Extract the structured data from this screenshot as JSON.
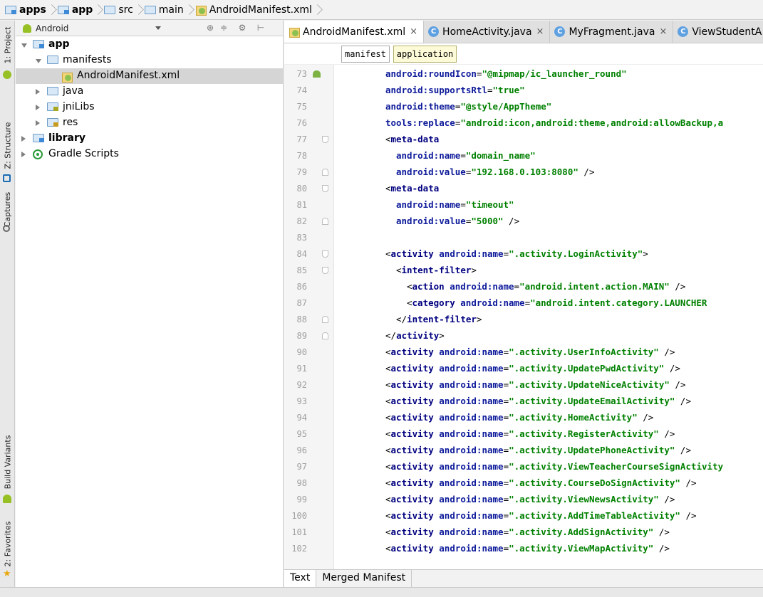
{
  "breadcrumb": [
    {
      "label": "apps",
      "bold": true,
      "icon": "module-folder"
    },
    {
      "label": "app",
      "bold": true,
      "icon": "module-folder"
    },
    {
      "label": "src",
      "bold": false,
      "icon": "folder"
    },
    {
      "label": "main",
      "bold": false,
      "icon": "folder"
    },
    {
      "label": "AndroidManifest.xml",
      "bold": false,
      "icon": "manifest-file"
    }
  ],
  "left_strip": {
    "project": "1: Project",
    "structure": "Z: Structure",
    "captures": "Captures",
    "build_variants": "Build Variants",
    "favorites": "2: Favorites"
  },
  "project_panel": {
    "view_mode": "Android",
    "tree": [
      {
        "label": "app",
        "bold": true,
        "icon": "module-folder",
        "level": 0,
        "arrow": "down"
      },
      {
        "label": "manifests",
        "bold": false,
        "icon": "folder",
        "level": 1,
        "arrow": "down"
      },
      {
        "label": "AndroidManifest.xml",
        "bold": false,
        "icon": "manifest-file",
        "level": 2,
        "arrow": "none",
        "selected": true
      },
      {
        "label": "java",
        "bold": false,
        "icon": "folder",
        "level": 1,
        "arrow": "right"
      },
      {
        "label": "jniLibs",
        "bold": false,
        "icon": "lib-folder",
        "level": 1,
        "arrow": "right"
      },
      {
        "label": "res",
        "bold": false,
        "icon": "res-folder",
        "level": 1,
        "arrow": "right"
      },
      {
        "label": "library",
        "bold": true,
        "icon": "module-folder",
        "level": 0,
        "arrow": "right"
      },
      {
        "label": "Gradle Scripts",
        "bold": false,
        "icon": "gradle",
        "level": 0,
        "arrow": "right"
      }
    ]
  },
  "editor_tabs": [
    {
      "label": "AndroidManifest.xml",
      "icon": "manifest-file",
      "active": true
    },
    {
      "label": "HomeActivity.java",
      "icon": "class",
      "active": false
    },
    {
      "label": "MyFragment.java",
      "icon": "class",
      "active": false
    },
    {
      "label": "ViewStudentA",
      "icon": "class",
      "active": false
    }
  ],
  "xml_crumbs": [
    {
      "label": "manifest",
      "active": false
    },
    {
      "label": "application",
      "active": true
    }
  ],
  "code_lines": [
    {
      "n": "73",
      "indent": 4,
      "fold": "",
      "droid": true,
      "parts": [
        [
          "attr",
          "android:roundIcon"
        ],
        [
          "punc",
          "="
        ],
        [
          "val",
          "\"@mipmap/ic_launcher_round\""
        ]
      ]
    },
    {
      "n": "74",
      "indent": 4,
      "fold": "",
      "parts": [
        [
          "attr",
          "android:supportsRtl"
        ],
        [
          "punc",
          "="
        ],
        [
          "val",
          "\"true\""
        ]
      ]
    },
    {
      "n": "75",
      "indent": 4,
      "fold": "",
      "parts": [
        [
          "attr",
          "android:theme"
        ],
        [
          "punc",
          "="
        ],
        [
          "val",
          "\"@style/AppTheme\""
        ]
      ]
    },
    {
      "n": "76",
      "indent": 4,
      "fold": "",
      "parts": [
        [
          "attr",
          "tools:replace"
        ],
        [
          "punc",
          "="
        ],
        [
          "val",
          "\"android:icon,android:theme,android:allowBackup,a"
        ]
      ]
    },
    {
      "n": "77",
      "indent": 4,
      "fold": "open",
      "parts": [
        [
          "punc",
          "<"
        ],
        [
          "tag",
          "meta-data"
        ]
      ]
    },
    {
      "n": "78",
      "indent": 6,
      "fold": "",
      "parts": [
        [
          "attr",
          "android:name"
        ],
        [
          "punc",
          "="
        ],
        [
          "val",
          "\"domain_name\""
        ]
      ]
    },
    {
      "n": "79",
      "indent": 6,
      "fold": "close",
      "parts": [
        [
          "attr",
          "android:value"
        ],
        [
          "punc",
          "="
        ],
        [
          "val",
          "\"192.168.0.103:8080\""
        ],
        [
          "punc",
          " />"
        ]
      ]
    },
    {
      "n": "80",
      "indent": 4,
      "fold": "open",
      "parts": [
        [
          "punc",
          "<"
        ],
        [
          "tag",
          "meta-data"
        ]
      ]
    },
    {
      "n": "81",
      "indent": 6,
      "fold": "",
      "parts": [
        [
          "attr",
          "android:name"
        ],
        [
          "punc",
          "="
        ],
        [
          "val",
          "\"timeout\""
        ]
      ]
    },
    {
      "n": "82",
      "indent": 6,
      "fold": "close",
      "parts": [
        [
          "attr",
          "android:value"
        ],
        [
          "punc",
          "="
        ],
        [
          "val",
          "\"5000\""
        ],
        [
          "punc",
          " />"
        ]
      ]
    },
    {
      "n": "83",
      "indent": 4,
      "fold": "",
      "parts": []
    },
    {
      "n": "84",
      "indent": 4,
      "fold": "open",
      "parts": [
        [
          "punc",
          "<"
        ],
        [
          "tag",
          "activity "
        ],
        [
          "attr",
          "android:name"
        ],
        [
          "punc",
          "="
        ],
        [
          "val",
          "\".activity.LoginActivity\""
        ],
        [
          "punc",
          ">"
        ]
      ]
    },
    {
      "n": "85",
      "indent": 6,
      "fold": "open",
      "parts": [
        [
          "punc",
          "<"
        ],
        [
          "tag",
          "intent-filter"
        ],
        [
          "punc",
          ">"
        ]
      ]
    },
    {
      "n": "86",
      "indent": 8,
      "fold": "",
      "parts": [
        [
          "punc",
          "<"
        ],
        [
          "tag",
          "action "
        ],
        [
          "attr",
          "android:name"
        ],
        [
          "punc",
          "="
        ],
        [
          "val",
          "\"android.intent.action.MAIN\""
        ],
        [
          "punc",
          " />"
        ]
      ]
    },
    {
      "n": "87",
      "indent": 8,
      "fold": "",
      "parts": [
        [
          "punc",
          "<"
        ],
        [
          "tag",
          "category "
        ],
        [
          "attr",
          "android:name"
        ],
        [
          "punc",
          "="
        ],
        [
          "val",
          "\"android.intent.category.LAUNCHER"
        ]
      ]
    },
    {
      "n": "88",
      "indent": 6,
      "fold": "close",
      "parts": [
        [
          "punc",
          "</"
        ],
        [
          "tag",
          "intent-filter"
        ],
        [
          "punc",
          ">"
        ]
      ]
    },
    {
      "n": "89",
      "indent": 4,
      "fold": "close",
      "parts": [
        [
          "punc",
          "</"
        ],
        [
          "tag",
          "activity"
        ],
        [
          "punc",
          ">"
        ]
      ]
    },
    {
      "n": "90",
      "indent": 4,
      "fold": "",
      "parts": [
        [
          "punc",
          "<"
        ],
        [
          "tag",
          "activity "
        ],
        [
          "attr",
          "android:name"
        ],
        [
          "punc",
          "="
        ],
        [
          "val",
          "\".activity.UserInfoActivity\""
        ],
        [
          "punc",
          " />"
        ]
      ]
    },
    {
      "n": "91",
      "indent": 4,
      "fold": "",
      "parts": [
        [
          "punc",
          "<"
        ],
        [
          "tag",
          "activity "
        ],
        [
          "attr",
          "android:name"
        ],
        [
          "punc",
          "="
        ],
        [
          "val",
          "\".activity.UpdatePwdActivity\""
        ],
        [
          "punc",
          " />"
        ]
      ]
    },
    {
      "n": "92",
      "indent": 4,
      "fold": "",
      "parts": [
        [
          "punc",
          "<"
        ],
        [
          "tag",
          "activity "
        ],
        [
          "attr",
          "android:name"
        ],
        [
          "punc",
          "="
        ],
        [
          "val",
          "\".activity.UpdateNiceActivity\""
        ],
        [
          "punc",
          " />"
        ]
      ]
    },
    {
      "n": "93",
      "indent": 4,
      "fold": "",
      "parts": [
        [
          "punc",
          "<"
        ],
        [
          "tag",
          "activity "
        ],
        [
          "attr",
          "android:name"
        ],
        [
          "punc",
          "="
        ],
        [
          "val",
          "\".activity.UpdateEmailActivity\""
        ],
        [
          "punc",
          " />"
        ]
      ]
    },
    {
      "n": "94",
      "indent": 4,
      "fold": "",
      "parts": [
        [
          "punc",
          "<"
        ],
        [
          "tag",
          "activity "
        ],
        [
          "attr",
          "android:name"
        ],
        [
          "punc",
          "="
        ],
        [
          "val",
          "\".activity.HomeActivity\""
        ],
        [
          "punc",
          " />"
        ]
      ]
    },
    {
      "n": "95",
      "indent": 4,
      "fold": "",
      "parts": [
        [
          "punc",
          "<"
        ],
        [
          "tag",
          "activity "
        ],
        [
          "attr",
          "android:name"
        ],
        [
          "punc",
          "="
        ],
        [
          "val",
          "\".activity.RegisterActivity\""
        ],
        [
          "punc",
          " />"
        ]
      ]
    },
    {
      "n": "96",
      "indent": 4,
      "fold": "",
      "parts": [
        [
          "punc",
          "<"
        ],
        [
          "tag",
          "activity "
        ],
        [
          "attr",
          "android:name"
        ],
        [
          "punc",
          "="
        ],
        [
          "val",
          "\".activity.UpdatePhoneActivity\""
        ],
        [
          "punc",
          " />"
        ]
      ]
    },
    {
      "n": "97",
      "indent": 4,
      "fold": "",
      "parts": [
        [
          "punc",
          "<"
        ],
        [
          "tag",
          "activity "
        ],
        [
          "attr",
          "android:name"
        ],
        [
          "punc",
          "="
        ],
        [
          "val",
          "\".activity.ViewTeacherCourseSignActivity"
        ]
      ]
    },
    {
      "n": "98",
      "indent": 4,
      "fold": "",
      "parts": [
        [
          "punc",
          "<"
        ],
        [
          "tag",
          "activity "
        ],
        [
          "attr",
          "android:name"
        ],
        [
          "punc",
          "="
        ],
        [
          "val",
          "\".activity.CourseDoSignActivity\""
        ],
        [
          "punc",
          " />"
        ]
      ]
    },
    {
      "n": "99",
      "indent": 4,
      "fold": "",
      "parts": [
        [
          "punc",
          "<"
        ],
        [
          "tag",
          "activity "
        ],
        [
          "attr",
          "android:name"
        ],
        [
          "punc",
          "="
        ],
        [
          "val",
          "\".activity.ViewNewsActivity\""
        ],
        [
          "punc",
          " />"
        ]
      ]
    },
    {
      "n": "100",
      "indent": 4,
      "fold": "",
      "parts": [
        [
          "punc",
          "<"
        ],
        [
          "tag",
          "activity "
        ],
        [
          "attr",
          "android:name"
        ],
        [
          "punc",
          "="
        ],
        [
          "val",
          "\".activity.AddTimeTableActivity\""
        ],
        [
          "punc",
          " />"
        ]
      ]
    },
    {
      "n": "101",
      "indent": 4,
      "fold": "",
      "parts": [
        [
          "punc",
          "<"
        ],
        [
          "tag",
          "activity "
        ],
        [
          "attr",
          "android:name"
        ],
        [
          "punc",
          "="
        ],
        [
          "val",
          "\".activity.AddSignActivity\""
        ],
        [
          "punc",
          " />"
        ]
      ]
    },
    {
      "n": "102",
      "indent": 4,
      "fold": "",
      "parts": [
        [
          "punc",
          "<"
        ],
        [
          "tag",
          "activity "
        ],
        [
          "attr",
          "android:name"
        ],
        [
          "punc",
          "="
        ],
        [
          "val",
          "\".activity.ViewMapActivity\""
        ],
        [
          "punc",
          " />"
        ]
      ]
    }
  ],
  "bottom_tabs": [
    {
      "label": "Text",
      "active": true
    },
    {
      "label": "Merged Manifest",
      "active": false
    }
  ]
}
